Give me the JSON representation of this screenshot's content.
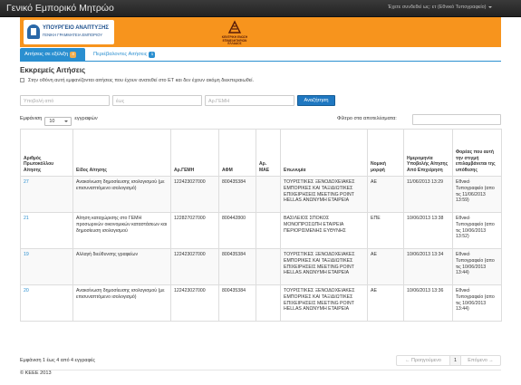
{
  "app": {
    "title": "Γενικό Εμπορικό Μητρώο"
  },
  "user_menu": {
    "label": "Έχετε συνδεθεί ως: ετ (Εθνικό Τυπογραφείο)"
  },
  "banner": {
    "ministry_title": "ΥΠΟΥΡΓΕΙΟ ΑΝΑΠΤΥΞΗΣ",
    "ministry_sub": "ΓΕΝΙΚΗ ΓΡΑΜΜΑΤΕΙΑ ΕΜΠΟΡΙΟΥ",
    "center_caption": "ΚΕΝΤΡΙΚΗ ΕΝΩΣΗ ΕΠΙΜΕΛΗΤΗΡΙΩΝ ΕΛΛΑΔΟΣ"
  },
  "tabs": [
    {
      "label": "Αιτήσεις σε εξέλιξη",
      "count": "4"
    },
    {
      "label": "Περιέβαλοντες Αιτήσεις",
      "count": "1"
    }
  ],
  "page": {
    "title": "Εκκρεμείς Αιτήσεις",
    "help": "Στην οθόνη αυτή εμφανίζονται αιτήσεις που έχουν ανατεθεί στο ΕΤ και δεν έχουν ακόμη διεκπεραιωθεί."
  },
  "filters": {
    "from_placeholder": "Υποβολή από",
    "to_placeholder": "έως",
    "gemi_placeholder": "Αρ.ΓΕΜΗ",
    "search_label": "Αναζήτηση"
  },
  "table_controls": {
    "show_label": "Εμφάνιση",
    "page_size": "10",
    "rows_label": "εγγραφών",
    "filter_label": "Φίλτρο στα αποτελέσματα:"
  },
  "columns": [
    "Αριθμός Πρωτοκόλλου Αίτησης",
    "Είδος Αίτησης",
    "Αρ.ΓΕΜΗ",
    "ΑΦΜ",
    "Αρ. ΜΑΕ",
    "Επωνυμία",
    "Νομική μορφή",
    "Ημερομηνία Υποβολής Αίτησης Από Επιχείρηση",
    "Φορέας που αυτή την στιγμή επιλαμβάνεται της υπόθεσης"
  ],
  "rows": [
    {
      "id": "27",
      "type": "Ανακοίνωση δημοσίευσης ισολογισμού (με επισυναπτόμενο ισολογισμό)",
      "gemi": "122423027000",
      "afm": "800435384",
      "mae": "",
      "name": "ΤΟΥΡΙΣΤΙΚΕΣ ΞΕΝΟΔΟΧΕΙΑΚΕΣ ΕΜΠΟΡΙΚΕΣ ΚΑΙ ΤΑΞΙΔΙΩΤΙΚΕΣ ΕΠΙΧΕΙΡΗΣΕΙΣ MEETING POINT HELLAS ΑΝΩΝΥΜΗ ΕΤΑΙΡΕΙΑ",
      "legal": "ΑΕ",
      "date": "11/06/2013 13:29",
      "handler": "Εθνικό Τυπογραφείο (απο τις 11/06/2013 13:59)"
    },
    {
      "id": "21",
      "type": "Αίτηση καταχώρισης στο ΓΕΜΗ προσωρινών οικονομικών καταστάσεων και δημοσίευση ισολογισμού",
      "gemi": "122827027000",
      "afm": "800442800",
      "mae": "",
      "name": "ΒΑΣΙΛΕΙΟΣ ΣΠΟΚΟΣ ΜΟΝΟΠΡΟΣΩΠΗ ΕΤΑΙΡΕΙΑ ΠΕΡΙΟΡΙΣΜΕΝΗΣ ΕΥΘΥΝΗΣ",
      "legal": "ΕΠΕ",
      "date": "10/06/2013 13:38",
      "handler": "Εθνικό Τυπογραφείο (απο τις 10/06/2013 13:52)"
    },
    {
      "id": "19",
      "type": "Αλλαγή διεύθυνσης γραφείων",
      "gemi": "122423027000",
      "afm": "800435384",
      "mae": "",
      "name": "ΤΟΥΡΙΣΤΙΚΕΣ ΞΕΝΟΔΟΧΕΙΑΚΕΣ ΕΜΠΟΡΙΚΕΣ ΚΑΙ ΤΑΞΙΔΙΩΤΙΚΕΣ ΕΠΙΧΕΙΡΗΣΕΙΣ MEETING POINT HELLAS ΑΝΩΝΥΜΗ ΕΤΑΙΡΕΙΑ",
      "legal": "ΑΕ",
      "date": "10/06/2013 13:34",
      "handler": "Εθνικό Τυπογραφείο (απο τις 10/06/2013 13:44)"
    },
    {
      "id": "20",
      "type": "Ανακοίνωση δημοσίευσης ισολογισμού (με επισυναπτόμενο ισολογισμό)",
      "gemi": "122423027000",
      "afm": "800435384",
      "mae": "",
      "name": "ΤΟΥΡΙΣΤΙΚΕΣ ΞΕΝΟΔΟΧΕΙΑΚΕΣ ΕΜΠΟΡΙΚΕΣ ΚΑΙ ΤΑΞΙΔΙΩΤΙΚΕΣ ΕΠΙΧΕΙΡΗΣΕΙΣ MEETING POINT HELLAS ΑΝΩΝΥΜΗ ΕΤΑΙΡΕΙΑ",
      "legal": "ΑΕ",
      "date": "10/06/2013 13:36",
      "handler": "Εθνικό Τυπογραφείο (απο τις 10/06/2013 13:44)"
    }
  ],
  "info": "Εμφάνιση 1 έως 4 από 4 εγγραφές",
  "pagination": {
    "prev": "← Προηγούμενο",
    "current": "1",
    "next": "Επόμενο →"
  },
  "footer": {
    "text": "© ΚΕΕΕ 2013"
  },
  "colors": {
    "accent": "#2a8fd0",
    "banner": "#f7941d",
    "navbar": "#2b2b2b",
    "badge_warn": "#f0ad4e"
  },
  "icons": {
    "ministry_emblem": "emblem-icon",
    "chamber_logo": "chamber-logo-icon",
    "dropdown": "caret-down-icon"
  }
}
